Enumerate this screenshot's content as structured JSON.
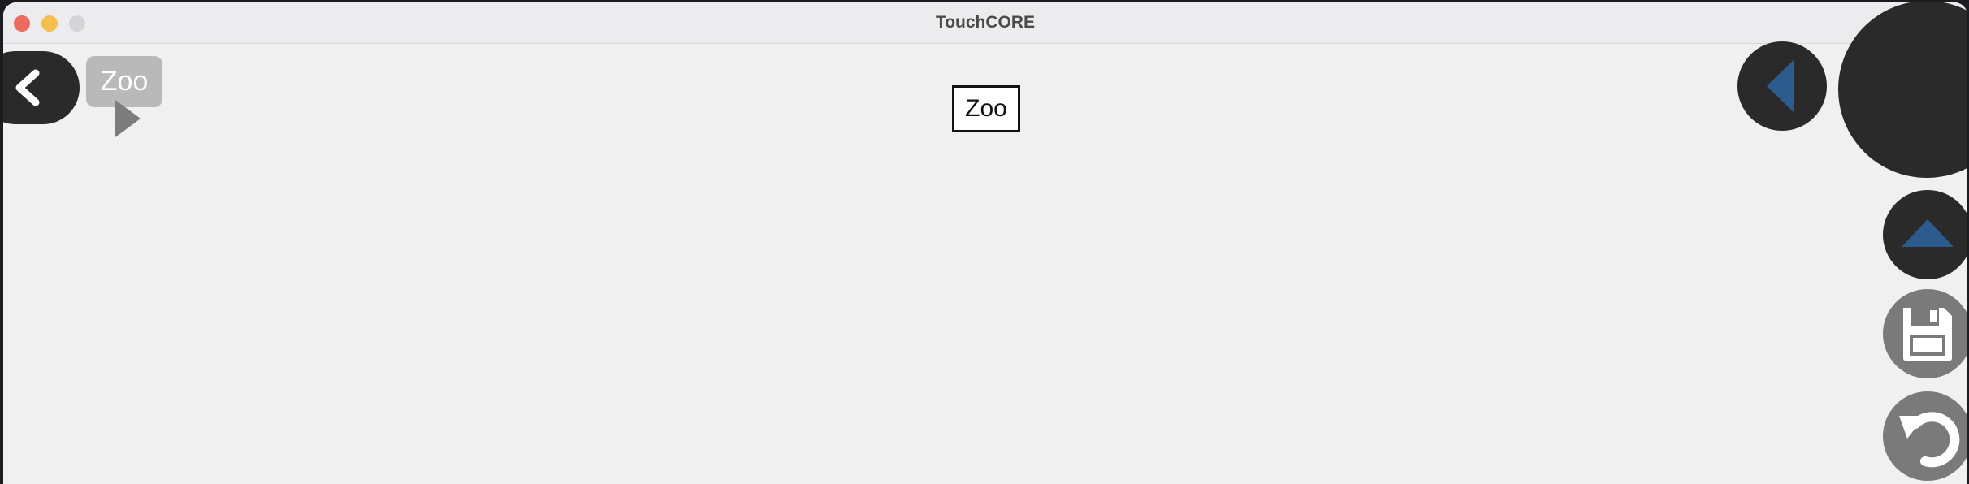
{
  "window": {
    "title": "TouchCORE"
  },
  "breadcrumb": {
    "items": [
      {
        "label": "Zoo"
      }
    ]
  },
  "canvas": {
    "classes": [
      {
        "name": "Zoo"
      }
    ]
  },
  "colors": {
    "button_dark": "#2a2a2a",
    "button_gray": "#7a7a7a",
    "arrow_blue": "#2c5b8e",
    "crumb_bg": "#b9b9b9",
    "canvas_bg": "#f0f0f0"
  },
  "icons": {
    "back": "chevron-left-icon",
    "collapse": "triangle-left-icon",
    "up": "triangle-up-icon",
    "save": "floppy-disk-icon",
    "undo": "undo-icon"
  }
}
